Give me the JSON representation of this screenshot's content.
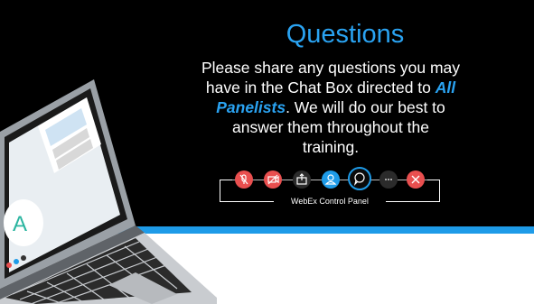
{
  "slide": {
    "title": "Questions",
    "body_line1": "Please share any questions you may",
    "body_line2_a": "have in the Chat Box directed to ",
    "body_line2_b": "All",
    "body_line3_a": "Panelists",
    "body_line3_b": ". We will do our best to",
    "body_line4": "answer them throughout the",
    "body_line5": "training."
  },
  "control_panel": {
    "label": "WebEx Control Panel",
    "buttons": [
      {
        "name": "mute",
        "icon": "microphone-off-icon",
        "color": "#e94f4f"
      },
      {
        "name": "video",
        "icon": "video-off-icon",
        "color": "#e94f4f"
      },
      {
        "name": "share",
        "icon": "share-icon",
        "color": "#2b2b2b"
      },
      {
        "name": "participants",
        "icon": "person-icon",
        "color": "#1e9be8"
      },
      {
        "name": "chat",
        "icon": "chat-bubble-icon",
        "color": "#0a0a0a"
      },
      {
        "name": "more",
        "icon": "more-icon",
        "color": "#2b2b2b"
      },
      {
        "name": "leave",
        "icon": "close-icon",
        "color": "#e94f4f"
      }
    ]
  },
  "colors": {
    "accent_blue": "#2aa3f2",
    "band_blue": "#1e9be8",
    "background": "#000000"
  }
}
